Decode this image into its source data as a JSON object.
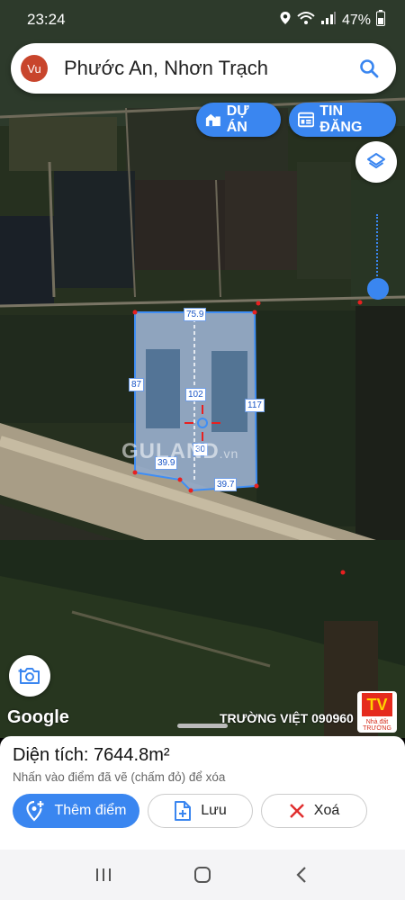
{
  "status_bar": {
    "time": "23:24",
    "battery": "47%"
  },
  "search": {
    "avatar_initials": "Vu",
    "query": "Phước An, Nhơn Trạch"
  },
  "chips": {
    "du_an": "DỰ ÁN",
    "tin_dang": "TIN ĐĂNG"
  },
  "map": {
    "edge_labels": [
      "75.9",
      "87",
      "102",
      "117",
      "30",
      "39.9",
      "39.7"
    ],
    "watermark_main": "GULAND",
    "watermark_suffix": ".vn",
    "attribution": "Google",
    "agent_name": "TRƯỜNG VIỆT 090960",
    "agent_logo_text": "TV",
    "agent_logo_sub": "Nhà đất TRƯỜNG"
  },
  "sheet": {
    "area_label": "Diện tích:",
    "area_value": "7644.8m²",
    "hint": "Nhấn vào điểm đã vẽ (chấm đỏ) để xóa",
    "add_point_label": "Thêm điểm",
    "save_label": "Lưu",
    "delete_label": "Xoá"
  },
  "colors": {
    "accent": "#3a86f0",
    "polygon_fill": "#9fc3f5",
    "delete_red": "#e02d2d"
  }
}
